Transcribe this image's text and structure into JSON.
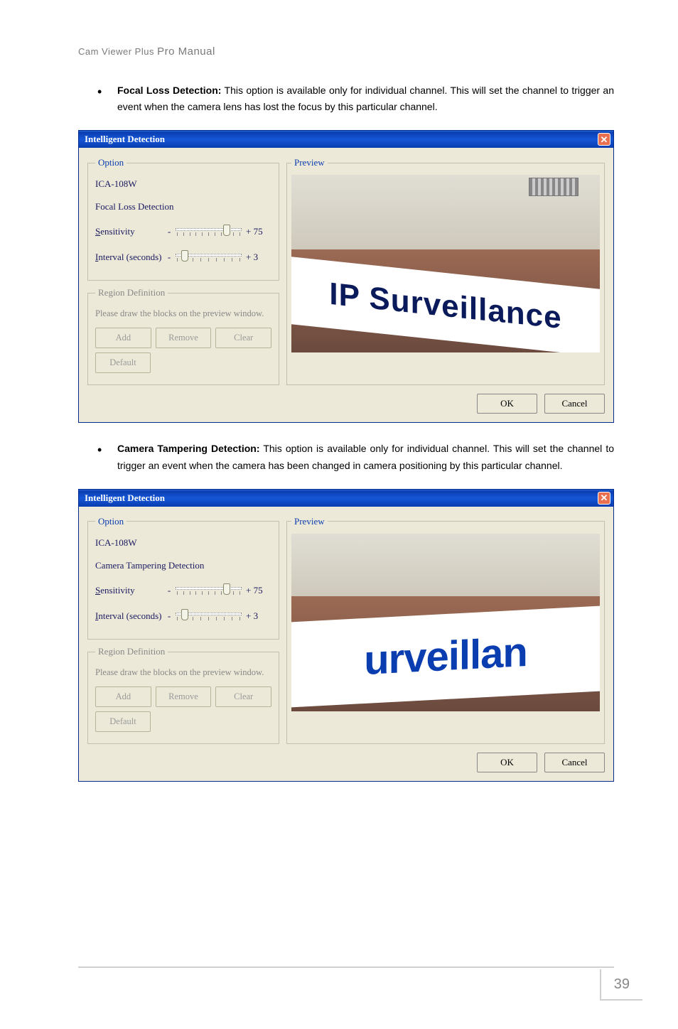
{
  "header": {
    "product": "Cam Viewer Plus",
    "suffix": "Pro Manual"
  },
  "sections": [
    {
      "heading": "Focal Loss Detection:",
      "body": "This option is available only for individual channel. This will set the channel to trigger an event when the camera lens has lost the focus by this particular channel."
    },
    {
      "heading": "Camera Tampering Detection:",
      "body": "This option is available only for individual channel. This will set the channel to trigger an event when the camera has been changed in camera positioning by this particular channel."
    }
  ],
  "dialog": {
    "title": "Intelligent Detection",
    "option_legend": "Option",
    "preview_legend": "Preview",
    "camera": "ICA-108W",
    "mode_focal": "Focal Loss Detection",
    "mode_tamper": "Camera Tampering Detection",
    "sensitivity_label_prefix": "S",
    "sensitivity_label_rest": "ensitivity",
    "sensitivity_value": "+ 75",
    "interval_label_prefix": "I",
    "interval_label_rest": "nterval (seconds)",
    "interval_value": "+ 3",
    "region_legend": "Region Definition",
    "region_instruction": "Please draw the blocks on the preview window.",
    "buttons": {
      "add": "Add",
      "remove": "Remove",
      "clear": "Clear",
      "default": "Default"
    },
    "ok": "OK",
    "cancel": "Cancel",
    "banner1": "IP Surveillance",
    "banner2": "urveillan"
  },
  "page_number": "39"
}
